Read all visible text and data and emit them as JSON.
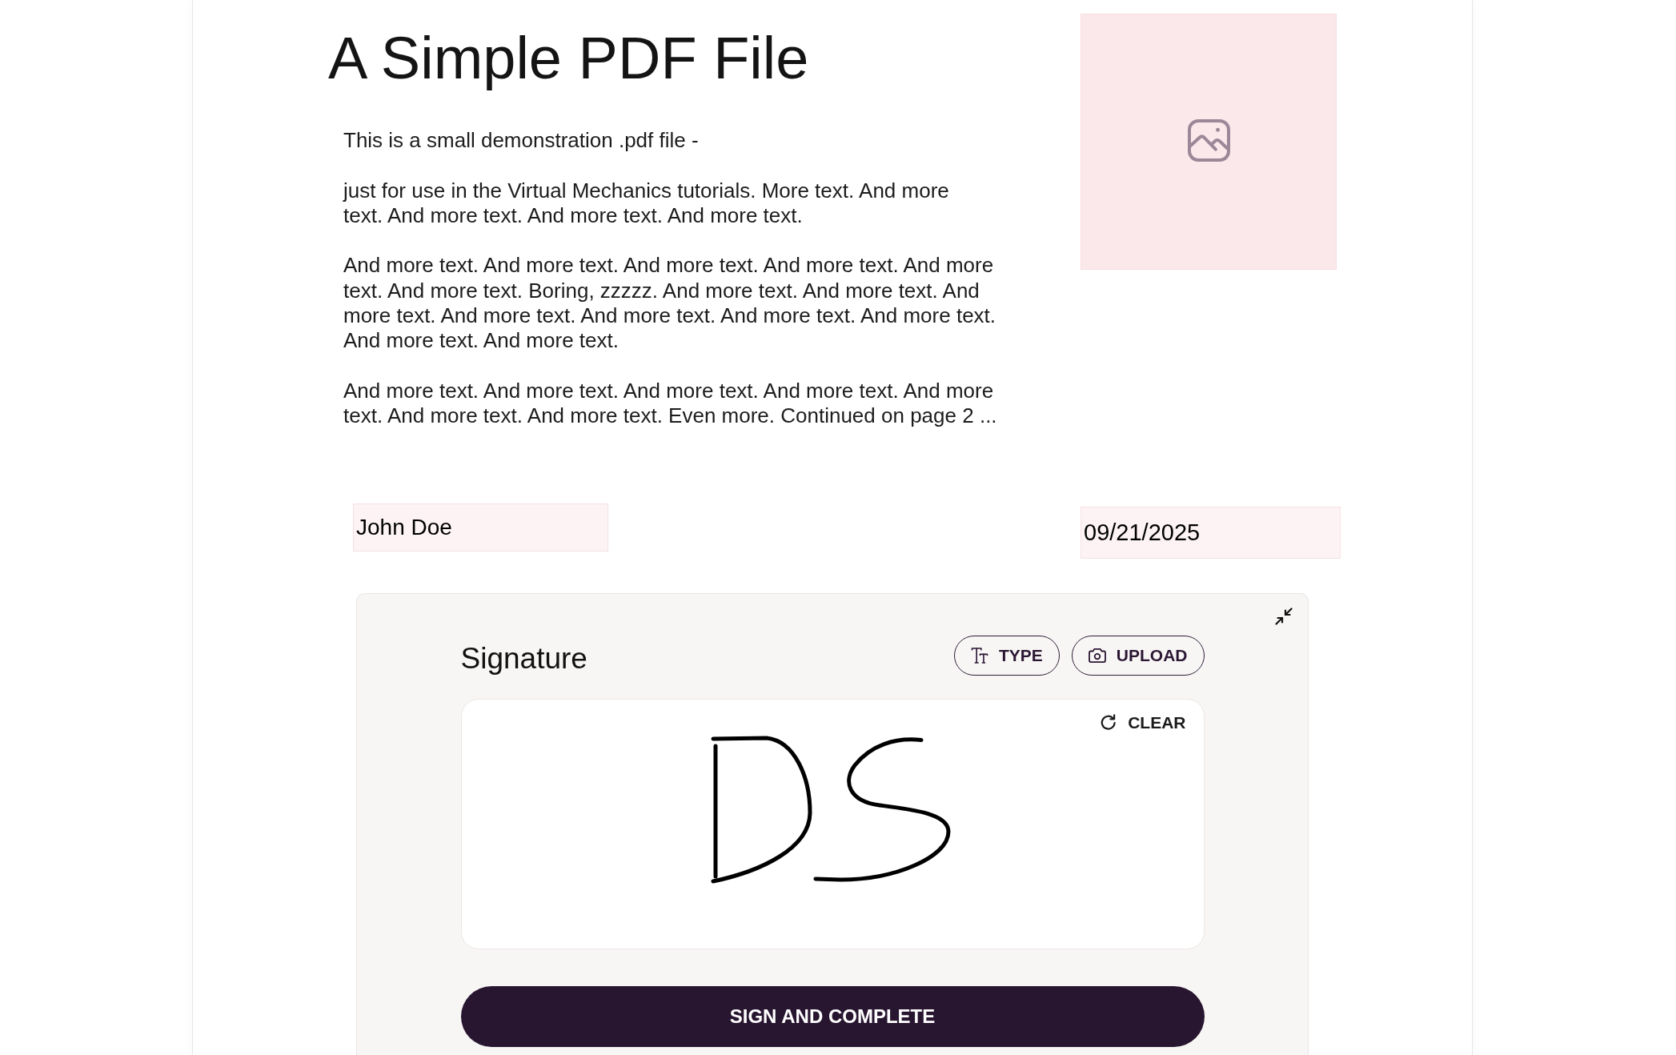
{
  "document": {
    "title": "A Simple PDF File",
    "paragraphs": [
      {
        "lines": [
          "This is a small demonstration .pdf file -"
        ]
      },
      {
        "lines": [
          "just for use in the Virtual Mechanics tutorials. More text. And more",
          "text. And more text. And more text. And more text."
        ]
      },
      {
        "lines": [
          "And more text. And more text. And more text. And more text. And more",
          "text. And more text. Boring, zzzzz. And more text. And more text. And",
          "more text. And more text. And more text. And more text. And more text.",
          "And more text. And more text."
        ]
      },
      {
        "lines": [
          "And more text. And more text. And more text. And more text. And more",
          "text. And more text. And more text. Even more. Continued on page 2 ..."
        ]
      }
    ]
  },
  "name_field": {
    "value": "John Doe"
  },
  "date_field": {
    "value": "09/21/2025"
  },
  "signature_panel": {
    "title": "Signature",
    "mode_buttons": [
      {
        "kind": "type",
        "label": "TYPE"
      },
      {
        "kind": "upload",
        "label": "UPLOAD"
      }
    ],
    "clear_button": {
      "label": "CLEAR"
    },
    "submit_button": {
      "label": "SIGN AND COMPLETE"
    }
  }
}
